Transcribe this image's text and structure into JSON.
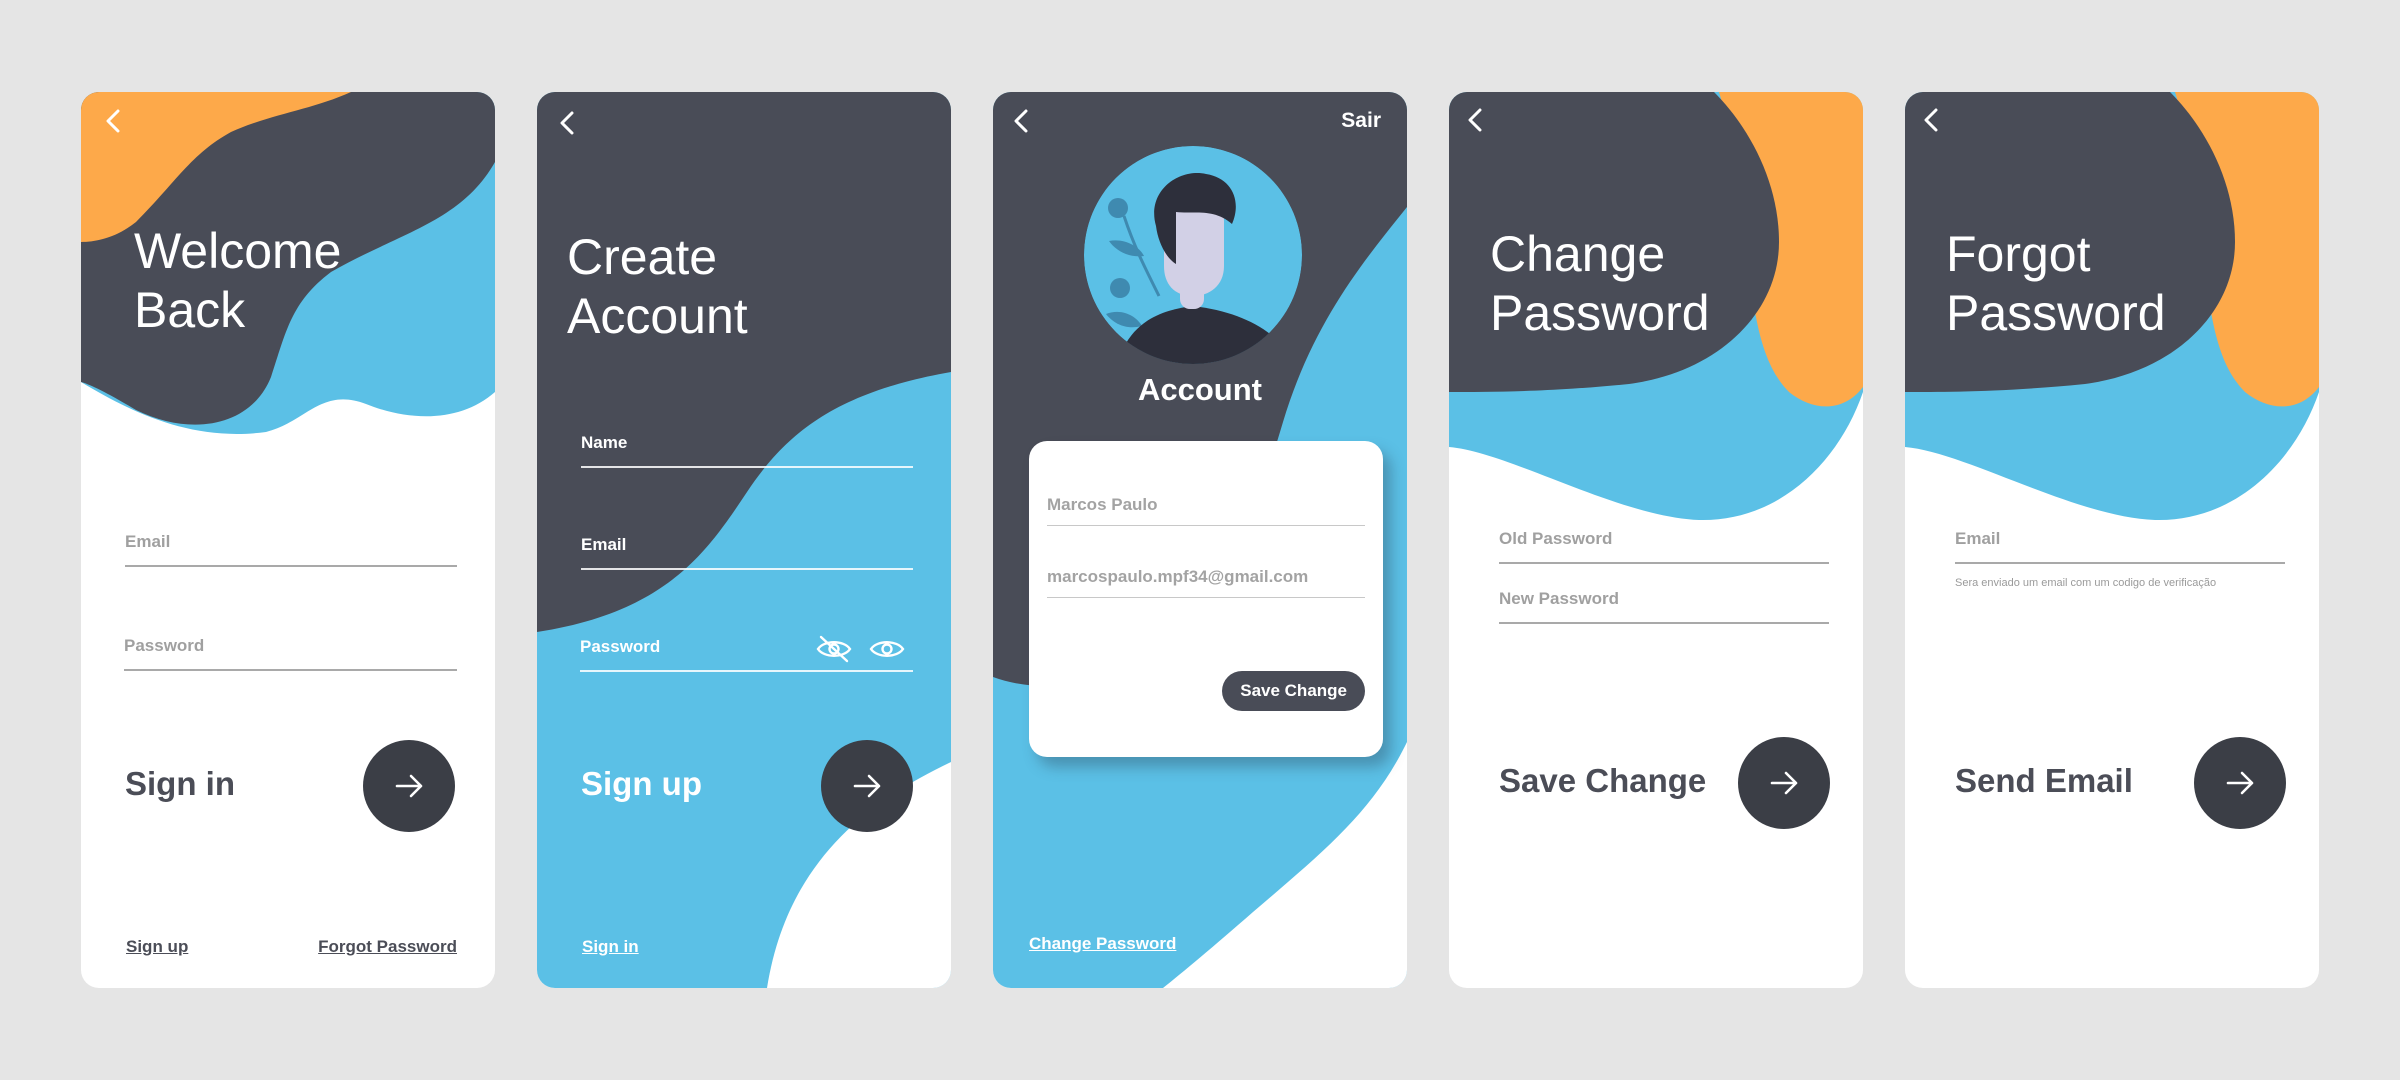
{
  "colors": {
    "page_bg": "#e5e5e5",
    "dark": "#494c57",
    "blue": "#5bc0e6",
    "orange": "#fda94a",
    "button": "#3b3e46",
    "text_dark": "#4b4d57",
    "field_grey": "#a0a0a0"
  },
  "icons": {
    "back": "chevron-left-icon",
    "submit": "arrow-right-icon",
    "hide": "eye-slash-icon",
    "show": "eye-icon"
  },
  "signin": {
    "title_line1": "Welcome",
    "title_line2": "Back",
    "email_label": "Email",
    "password_label": "Password",
    "action": "Sign in",
    "link_signup": "Sign up",
    "link_forgot": "Forgot Password"
  },
  "signup": {
    "title_line1": "Create",
    "title_line2": "Account",
    "name_label": "Name",
    "email_label": "Email",
    "password_label": "Password",
    "action": "Sign up",
    "link_signin": "Sign in"
  },
  "account": {
    "logout": "Sair",
    "title": "Account",
    "name_value": "Marcos Paulo",
    "email_value": "marcospaulo.mpf34@gmail.com",
    "save_button": "Save Change",
    "link_change_password": "Change Password"
  },
  "change_password": {
    "title_line1": "Change",
    "title_line2": "Password",
    "old_label": "Old Password",
    "new_label": "New Password",
    "action": "Save Change"
  },
  "forgot_password": {
    "title_line1": "Forgot",
    "title_line2": "Password",
    "email_label": "Email",
    "hint": "Sera enviado um email com um codigo de verificação",
    "action": "Send Email"
  }
}
